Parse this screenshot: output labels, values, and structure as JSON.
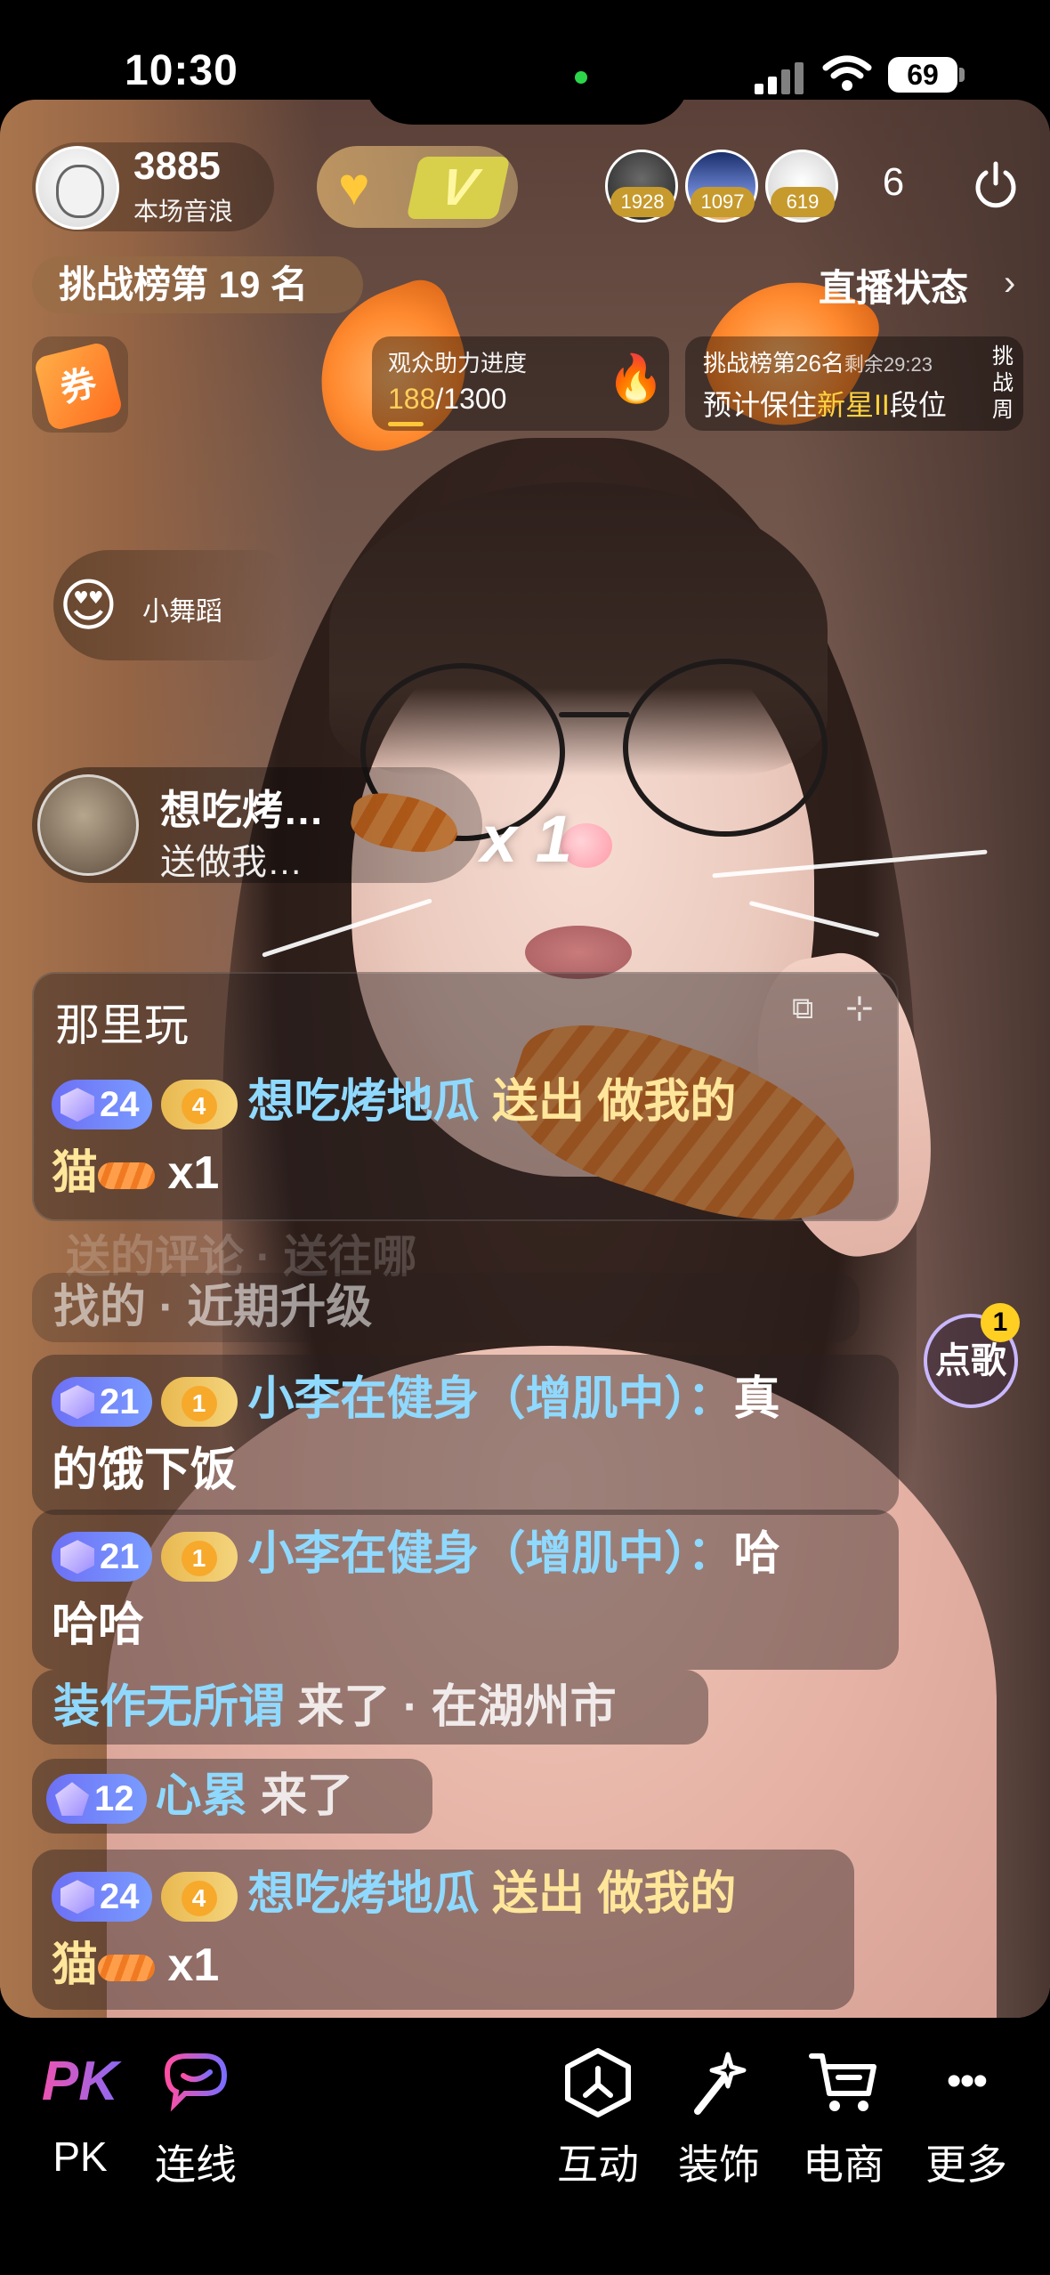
{
  "status_bar": {
    "time": "10:30",
    "battery": "69"
  },
  "host": {
    "score": "3885",
    "score_label": "本场音浪"
  },
  "viewers": {
    "top": [
      {
        "count": "1928"
      },
      {
        "count": "1097"
      },
      {
        "count": "619"
      }
    ],
    "online_count": "6"
  },
  "rank": {
    "label": "挑战榜第 19 名"
  },
  "live_status": {
    "label": "直播状态",
    "arrow": "›"
  },
  "coupon": {
    "label": "券"
  },
  "assist": {
    "title": "观众助力进度",
    "current": "188",
    "total": "/1300",
    "flame": "🔥"
  },
  "challenge": {
    "title": "挑战榜第26名",
    "remaining": "剩余29:23",
    "line_prefix": "预计保住",
    "line_highlight": "新星II",
    "line_suffix": "段位",
    "side": "挑战周"
  },
  "effects": {
    "dance_label": "小舞蹈",
    "dance_emoji": "😍",
    "gift_line1": "想吃烤…",
    "gift_line2": "送做我…",
    "gift_multiplier": "x 1"
  },
  "pinned": {
    "title": "那里玩",
    "icon1": "⧉",
    "icon2": "⊹"
  },
  "messages": [
    {
      "level": "24",
      "fan": "4",
      "user": "想吃烤地瓜",
      "text": " 送出 做我的",
      "text2": "猫",
      "suffix": " x1"
    },
    {
      "faded_ghost": "送的评论 · 送往哪",
      "faded": "找的 · 近期升级"
    },
    {
      "level": "21",
      "fan": "1",
      "user": "小李在健身（增肌中）：",
      "text": "真",
      "text2": "的饿下饭"
    },
    {
      "level": "21",
      "fan": "1",
      "user": "小李在健身（增肌中）：",
      "text": "哈",
      "text2": "哈哈"
    },
    {
      "user": "装作无所谓",
      "text": " 来了 · 在湖州市"
    },
    {
      "level": "12",
      "user": "心累",
      "text": " 来了"
    },
    {
      "level": "24",
      "fan": "4",
      "user": "想吃烤地瓜",
      "text": " 送出 做我的",
      "text2": "猫",
      "suffix": " x1"
    }
  ],
  "song": {
    "label": "点歌",
    "badge": "1"
  },
  "toolbar": {
    "pk": {
      "icon": "PK",
      "label": "PK"
    },
    "link": {
      "label": "连线"
    },
    "interact": {
      "label": "互动"
    },
    "decor": {
      "label": "装饰"
    },
    "shop": {
      "label": "电商"
    },
    "more": {
      "label": "更多",
      "icon": "•••"
    }
  },
  "colors": {
    "accent_purple": "#6d70f5",
    "nick_blue": "#8fd9ff",
    "gold": "#ffd05a"
  }
}
